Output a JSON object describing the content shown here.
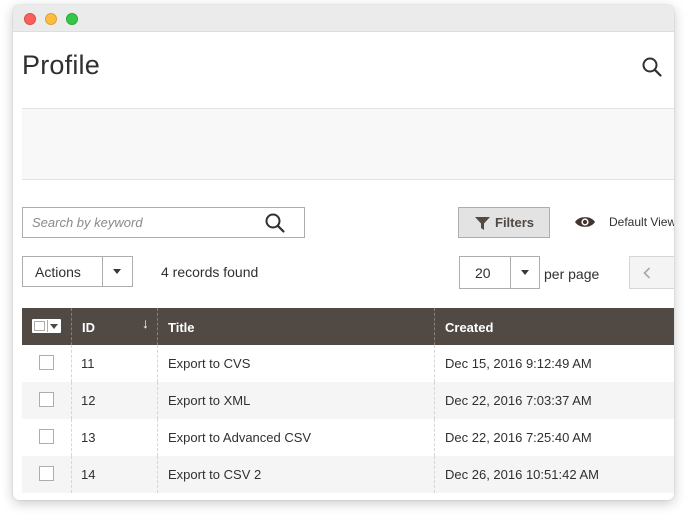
{
  "page": {
    "title": "Profile"
  },
  "toolbar": {
    "search_placeholder": "Search by keyword",
    "filters_label": "Filters",
    "default_view_label": "Default View",
    "actions_label": "Actions",
    "records_found": "4 records found",
    "per_page_value": "20",
    "per_page_label": "per page"
  },
  "grid": {
    "columns": [
      "ID",
      "Title",
      "Created"
    ],
    "rows": [
      {
        "id": "11",
        "title": "Export to CVS",
        "created": "Dec 15, 2016 9:12:49 AM"
      },
      {
        "id": "12",
        "title": "Export to XML",
        "created": "Dec 22, 2016 7:03:37 AM"
      },
      {
        "id": "13",
        "title": "Export to Advanced CSV",
        "created": "Dec 22, 2016 7:25:40 AM"
      },
      {
        "id": "14",
        "title": "Export to CSV 2",
        "created": "Dec 26, 2016 10:51:42 AM"
      }
    ]
  },
  "icons": {
    "top_search": "search-icon",
    "search_button": "search-icon",
    "filters": "funnel-icon",
    "default_view": "eye-icon",
    "prev_page": "chevron-left-icon",
    "sort": "arrow-down-icon"
  },
  "colors": {
    "header_bg": "#514943",
    "filters_bg": "#e3e3e3",
    "panel_bg": "#f8f8f8",
    "row_alt_bg": "#f5f5f5"
  }
}
